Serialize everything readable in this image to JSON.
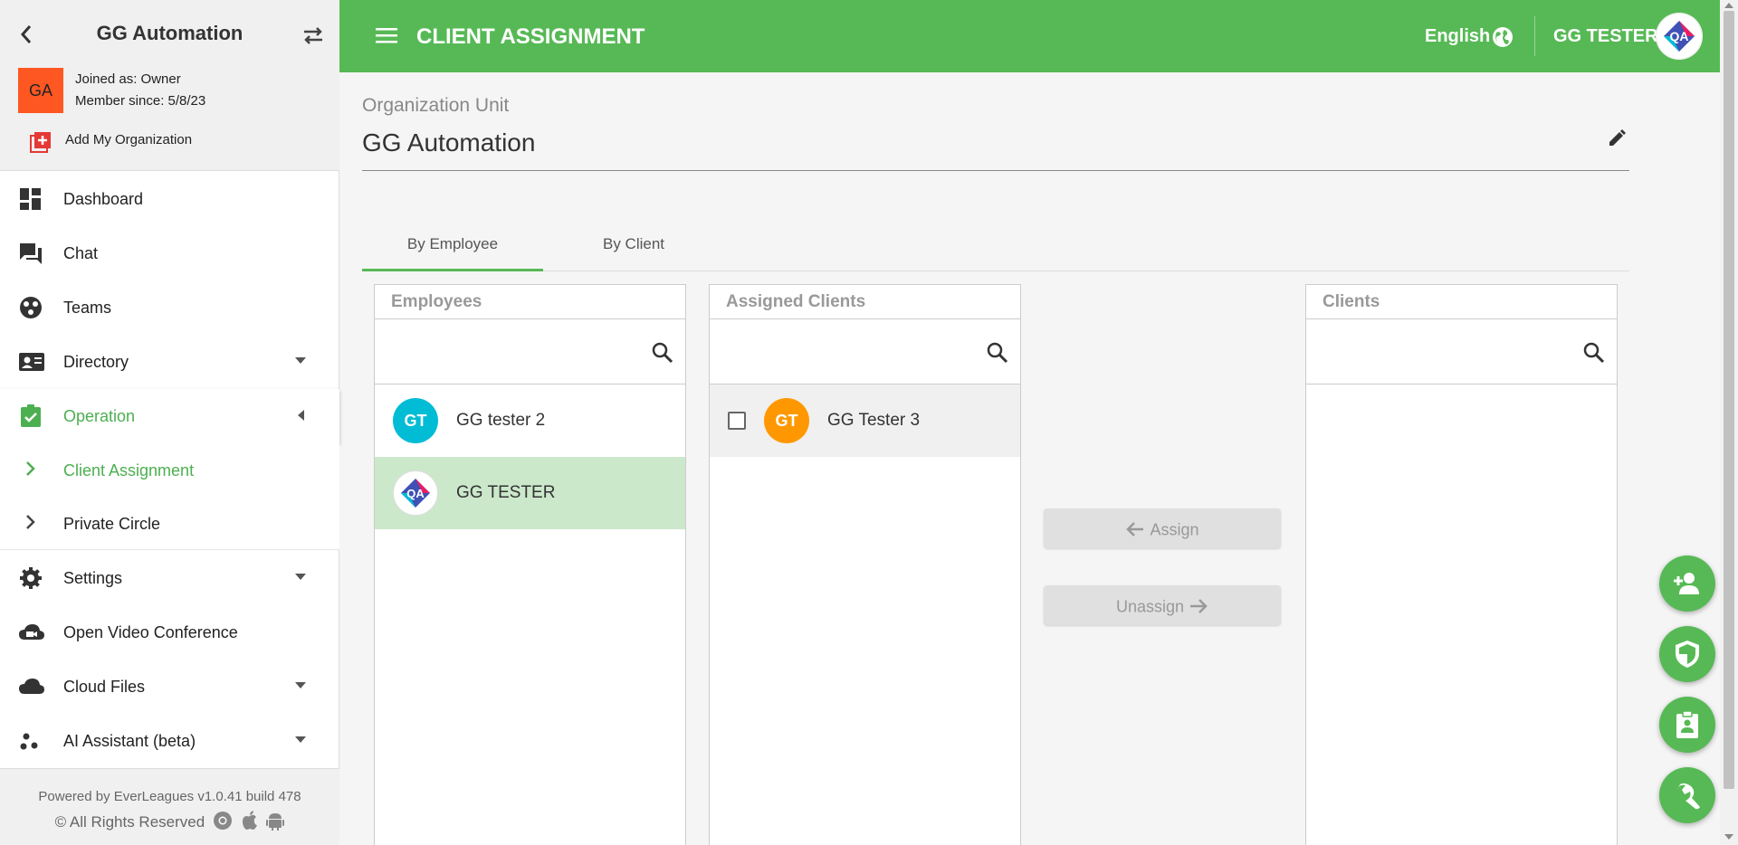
{
  "sidebar": {
    "org_title": "GG Automation",
    "avatar_initials": "GA",
    "joined": "Joined as: Owner",
    "member_since": "Member since: 5/8/23",
    "add_org": "Add My Organization",
    "items": [
      {
        "label": "Dashboard",
        "icon": "dashboard-icon"
      },
      {
        "label": "Chat",
        "icon": "chat-icon"
      },
      {
        "label": "Teams",
        "icon": "teams-icon"
      },
      {
        "label": "Directory",
        "icon": "directory-icon"
      },
      {
        "label": "Operation",
        "icon": "operation-icon"
      },
      {
        "label": "Settings",
        "icon": "gear-icon"
      },
      {
        "label": "Open Video Conference",
        "icon": "video-cloud-icon"
      },
      {
        "label": "Cloud Files",
        "icon": "cloud-icon"
      },
      {
        "label": "AI Assistant (beta)",
        "icon": "ai-icon"
      }
    ],
    "sub_items": [
      {
        "label": "Client Assignment"
      },
      {
        "label": "Private Circle"
      }
    ],
    "footer_powered": "Powered by EverLeagues v1.0.41 build 478",
    "footer_rights": "© All Rights Reserved",
    "active_color": "#4caf50"
  },
  "header": {
    "title": "CLIENT ASSIGNMENT",
    "language": "English",
    "user_name": "GG TESTER",
    "bar_color": "#57b955"
  },
  "main": {
    "org_unit_label": "Organization Unit",
    "org_unit_value": "GG Automation",
    "tabs": [
      {
        "label": "By Employee",
        "active": true
      },
      {
        "label": "By Client",
        "active": false
      }
    ],
    "employees": {
      "title": "Employees",
      "search_value": "",
      "rows": [
        {
          "initials": "GT",
          "name": "GG tester 2",
          "avatar_color": "#00bcd4",
          "selected": false
        },
        {
          "initials": "",
          "name": "GG TESTER",
          "avatar_color": "#ffffff",
          "selected": true
        }
      ]
    },
    "assigned": {
      "title": "Assigned Clients",
      "search_value": "",
      "rows": [
        {
          "initials": "GT",
          "name": "GG Tester 3",
          "avatar_color": "#ff9800",
          "checked": false
        }
      ]
    },
    "clients": {
      "title": "Clients",
      "search_value": "",
      "rows": []
    },
    "assign_label": "Assign",
    "unassign_label": "Unassign"
  },
  "fabs": [
    "add-person-icon",
    "shield-icon",
    "badge-icon",
    "wrench-icon"
  ]
}
